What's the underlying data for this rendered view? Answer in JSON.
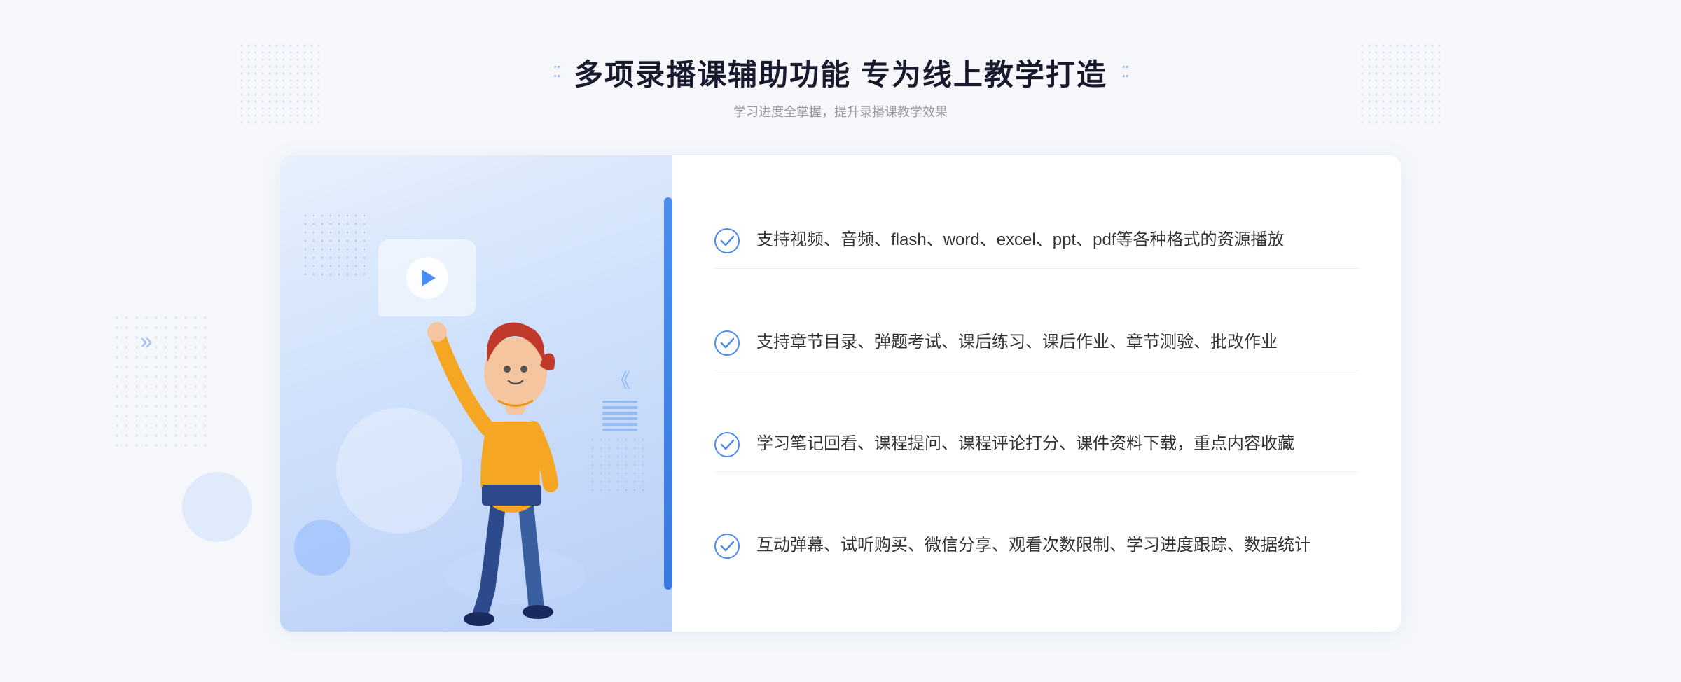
{
  "page": {
    "background": "#f5f7fa"
  },
  "header": {
    "title": "多项录播课辅助功能 专为线上教学打造",
    "subtitle": "学习进度全掌握，提升录播课教学效果",
    "deco_left": "⁚⁚",
    "deco_right": "⁚⁚"
  },
  "features": [
    {
      "id": 1,
      "text": "支持视频、音频、flash、word、excel、ppt、pdf等各种格式的资源播放"
    },
    {
      "id": 2,
      "text": "支持章节目录、弹题考试、课后练习、课后作业、章节测验、批改作业"
    },
    {
      "id": 3,
      "text": "学习笔记回看、课程提问、课程评论打分、课件资料下载，重点内容收藏"
    },
    {
      "id": 4,
      "text": "互动弹幕、试听购买、微信分享、观看次数限制、学习进度跟踪、数据统计"
    }
  ],
  "colors": {
    "primary": "#4a8cf0",
    "title": "#1a1a2e",
    "text": "#333333",
    "subtitle": "#999999",
    "check": "#4a8cf0",
    "bg": "#f5f7fa"
  }
}
